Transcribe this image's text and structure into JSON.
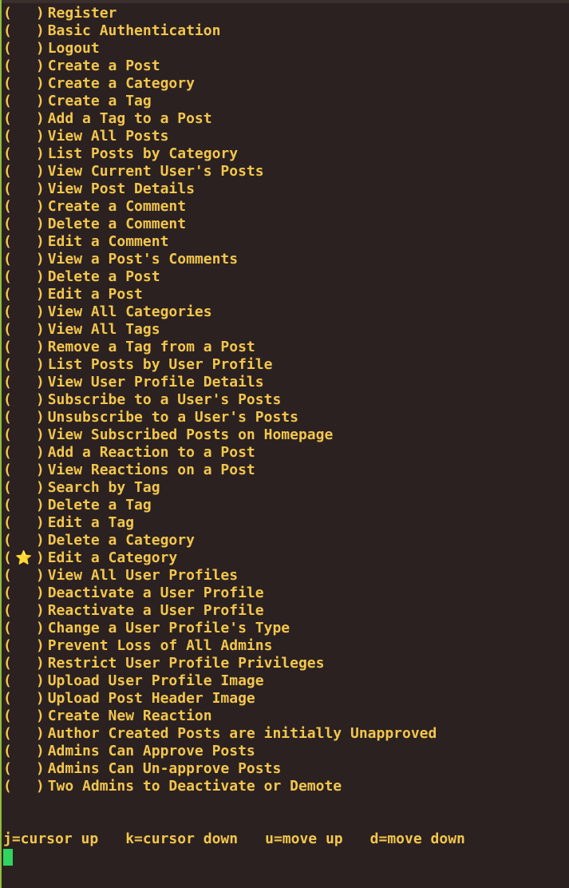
{
  "checklist": {
    "items": [
      {
        "checked": false,
        "label": "Register"
      },
      {
        "checked": false,
        "label": "Basic Authentication"
      },
      {
        "checked": false,
        "label": "Logout"
      },
      {
        "checked": false,
        "label": "Create a Post"
      },
      {
        "checked": false,
        "label": "Create a Category"
      },
      {
        "checked": false,
        "label": "Create a Tag"
      },
      {
        "checked": false,
        "label": "Add a Tag to a Post"
      },
      {
        "checked": false,
        "label": "View All Posts"
      },
      {
        "checked": false,
        "label": "List Posts by Category"
      },
      {
        "checked": false,
        "label": "View Current User's Posts"
      },
      {
        "checked": false,
        "label": "View Post Details"
      },
      {
        "checked": false,
        "label": "Create a Comment"
      },
      {
        "checked": false,
        "label": "Delete a Comment"
      },
      {
        "checked": false,
        "label": "Edit a Comment"
      },
      {
        "checked": false,
        "label": "View a Post's Comments"
      },
      {
        "checked": false,
        "label": "Delete a Post"
      },
      {
        "checked": false,
        "label": "Edit a Post"
      },
      {
        "checked": false,
        "label": "View All Categories"
      },
      {
        "checked": false,
        "label": "View All Tags"
      },
      {
        "checked": false,
        "label": "Remove a Tag from a Post"
      },
      {
        "checked": false,
        "label": "List Posts by User Profile"
      },
      {
        "checked": false,
        "label": "View User Profile Details"
      },
      {
        "checked": false,
        "label": "Subscribe to a User's Posts"
      },
      {
        "checked": false,
        "label": "Unsubscribe to a User's Posts"
      },
      {
        "checked": false,
        "label": "View Subscribed Posts on Homepage"
      },
      {
        "checked": false,
        "label": "Add a Reaction to a Post"
      },
      {
        "checked": false,
        "label": "View Reactions on a Post"
      },
      {
        "checked": false,
        "label": "Search by Tag"
      },
      {
        "checked": false,
        "label": "Delete a Tag"
      },
      {
        "checked": false,
        "label": "Edit a Tag"
      },
      {
        "checked": false,
        "label": "Delete a Category"
      },
      {
        "checked": true,
        "label": "Edit a Category"
      },
      {
        "checked": false,
        "label": "View All User Profiles"
      },
      {
        "checked": false,
        "label": "Deactivate a User Profile"
      },
      {
        "checked": false,
        "label": "Reactivate a User Profile"
      },
      {
        "checked": false,
        "label": "Change a User Profile's Type"
      },
      {
        "checked": false,
        "label": "Prevent Loss of All Admins"
      },
      {
        "checked": false,
        "label": "Restrict User Profile Privileges"
      },
      {
        "checked": false,
        "label": "Upload User Profile Image"
      },
      {
        "checked": false,
        "label": "Upload Post Header Image"
      },
      {
        "checked": false,
        "label": "Create New Reaction"
      },
      {
        "checked": false,
        "label": "Author Created Posts are initially Unapproved"
      },
      {
        "checked": false,
        "label": "Admins Can Approve Posts"
      },
      {
        "checked": false,
        "label": "Admins Can Un-approve Posts"
      },
      {
        "checked": false,
        "label": "Two Admins to Deactivate or Demote"
      }
    ],
    "open_paren": "(",
    "close_paren": ")",
    "checked_mark": "⭐",
    "unchecked_mark": " ",
    "checked_icon": "star-icon"
  },
  "help_bar": {
    "cursor_up": "j=cursor up",
    "cursor_down": "k=cursor down",
    "move_up": "u=move up",
    "move_down": "d=move down"
  },
  "colors": {
    "background": "#2b2120",
    "text": "#f2c64d",
    "cursor": "#2fd55f"
  }
}
